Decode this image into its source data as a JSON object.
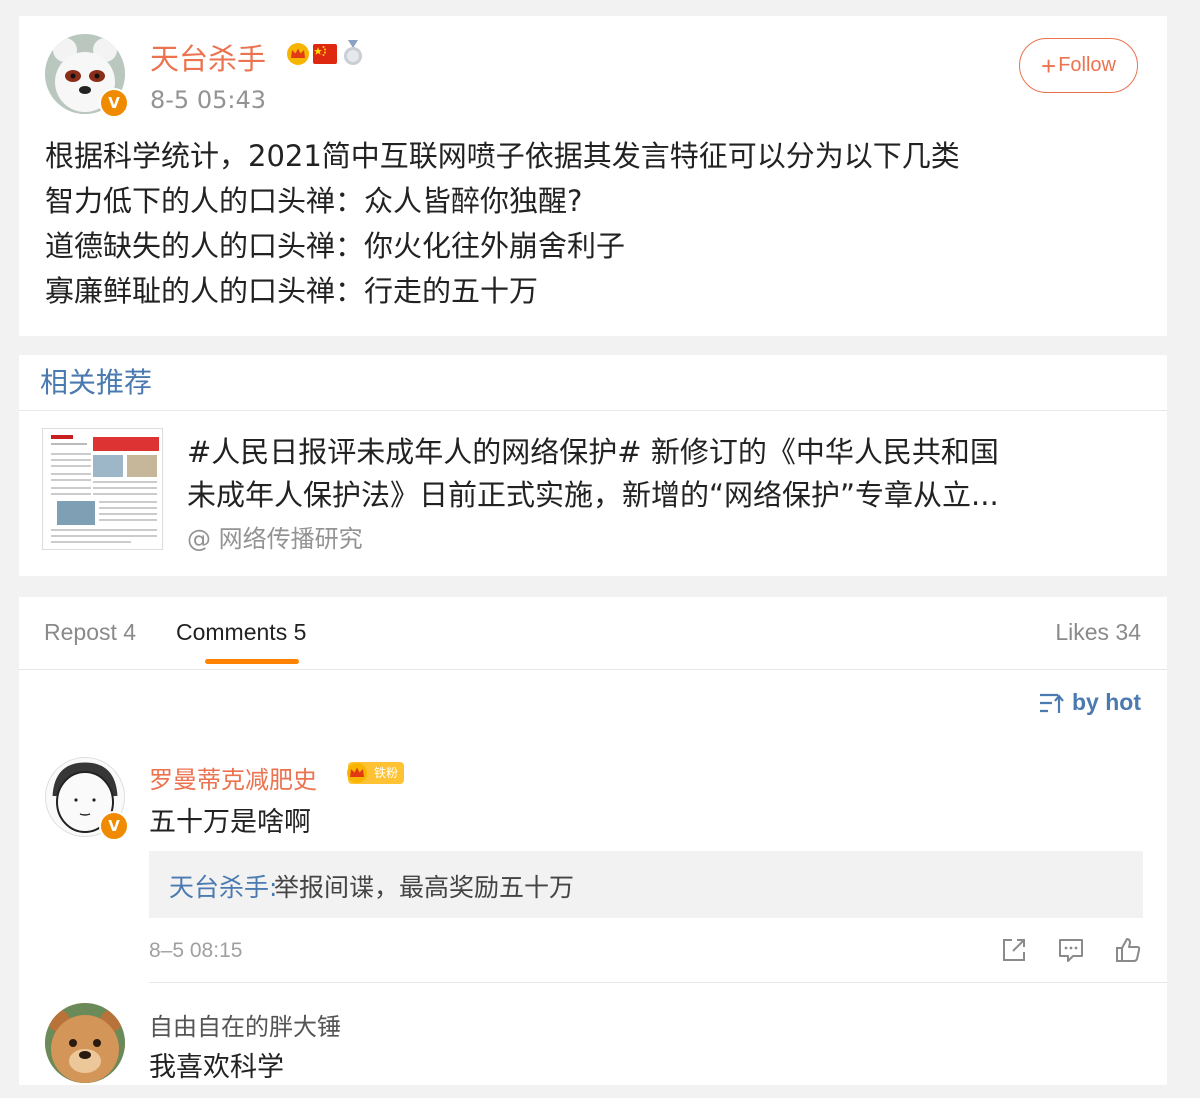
{
  "post": {
    "author": "天台杀手",
    "time": "8-5 05:43",
    "follow_label": "Follow",
    "lines": [
      "根据科学统计，2021简中互联网喷子依据其发言特征可以分为以下几类",
      "智力低下的人的口头禅：众人皆醉你独醒?",
      "道德缺失的人的口头禅：你火化往外崩舍利子",
      "寡廉鲜耻的人的口头禅：行走的五十万"
    ],
    "badges": [
      "crown-icon",
      "china-flag-icon",
      "medal-icon"
    ],
    "verified_badge": "V"
  },
  "related": {
    "title": "相关推荐",
    "lines": [
      "#人民日报评未成年人的网络保护# 新修订的《中华人民共和国",
      "未成年人保护法》日前正式实施，新增的“网络保护”专章从立..."
    ],
    "source": "@ 网络传播研究"
  },
  "tabs": {
    "repost": "Repost 4",
    "comments": "Comments 5",
    "likes": "Likes 34"
  },
  "sort_label": "by hot",
  "comments": [
    {
      "author": "罗曼蒂克减肥史",
      "fan_badge": "铁粉",
      "text": "五十万是啥啊",
      "reply_author": "天台杀手:",
      "reply_text": "举报间谍，最高奖励五十万",
      "time": "8–5 08:15"
    },
    {
      "author": "自由自在的胖大锤",
      "text": "我喜欢科学"
    }
  ],
  "colors": {
    "accent_orange": "#eb7350",
    "link_blue": "#4a7ab0",
    "tab_underline": "#ff8200"
  }
}
